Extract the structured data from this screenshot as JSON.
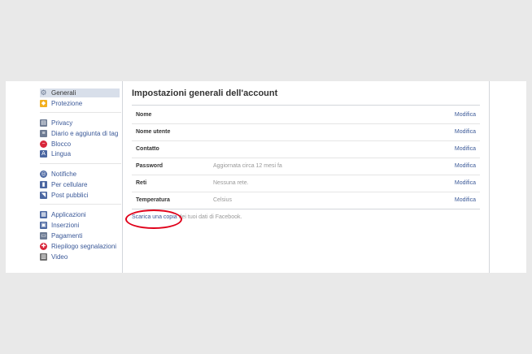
{
  "sidebar": {
    "items": [
      {
        "label": "Generali",
        "icon": "gear-icon",
        "color": "#6d7b93",
        "active": true
      },
      {
        "label": "Protezione",
        "icon": "shield-icon",
        "color": "#f2b020"
      },
      {
        "label": "Privacy",
        "icon": "lock-icon",
        "color": "#6d7b93"
      },
      {
        "label": "Diario e aggiunta di tag",
        "icon": "timeline-icon",
        "color": "#6d7b93"
      },
      {
        "label": "Blocco",
        "icon": "block-icon",
        "color": "#d8263a"
      },
      {
        "label": "Lingua",
        "icon": "language-icon",
        "color": "#4b67a1"
      },
      {
        "label": "Notifiche",
        "icon": "globe-icon",
        "color": "#4b67a1"
      },
      {
        "label": "Per cellulare",
        "icon": "mobile-icon",
        "color": "#4b67a1"
      },
      {
        "label": "Post pubblici",
        "icon": "rss-icon",
        "color": "#4b67a1"
      },
      {
        "label": "Applicazioni",
        "icon": "apps-icon",
        "color": "#4b67a1"
      },
      {
        "label": "Inserzioni",
        "icon": "ads-icon",
        "color": "#4b67a1"
      },
      {
        "label": "Pagamenti",
        "icon": "card-icon",
        "color": "#6d7b93"
      },
      {
        "label": "Riepilogo segnalazioni",
        "icon": "lifebuoy-icon",
        "color": "#d8263a"
      },
      {
        "label": "Video",
        "icon": "film-icon",
        "color": "#6d6d6d"
      }
    ]
  },
  "main": {
    "title": "Impostazioni generali dell'account",
    "rows": [
      {
        "label": "Nome",
        "value": "",
        "edit": "Modifica"
      },
      {
        "label": "Nome utente",
        "value": "",
        "edit": "Modifica"
      },
      {
        "label": "Contatto",
        "value": "",
        "edit": "Modifica"
      },
      {
        "label": "Password",
        "value": "Aggiornata circa 12 mesi fa",
        "edit": "Modifica"
      },
      {
        "label": "Reti",
        "value": "Nessuna rete.",
        "edit": "Modifica"
      },
      {
        "label": "Temperatura",
        "value": "Celsius",
        "edit": "Modifica"
      }
    ],
    "download_link": "Scarica una copia",
    "download_rest": " dei tuoi dati di Facebook."
  },
  "colors": {
    "link": "#3b5998",
    "highlight_circle": "#e0001a",
    "active_bg": "#d8dfea"
  }
}
